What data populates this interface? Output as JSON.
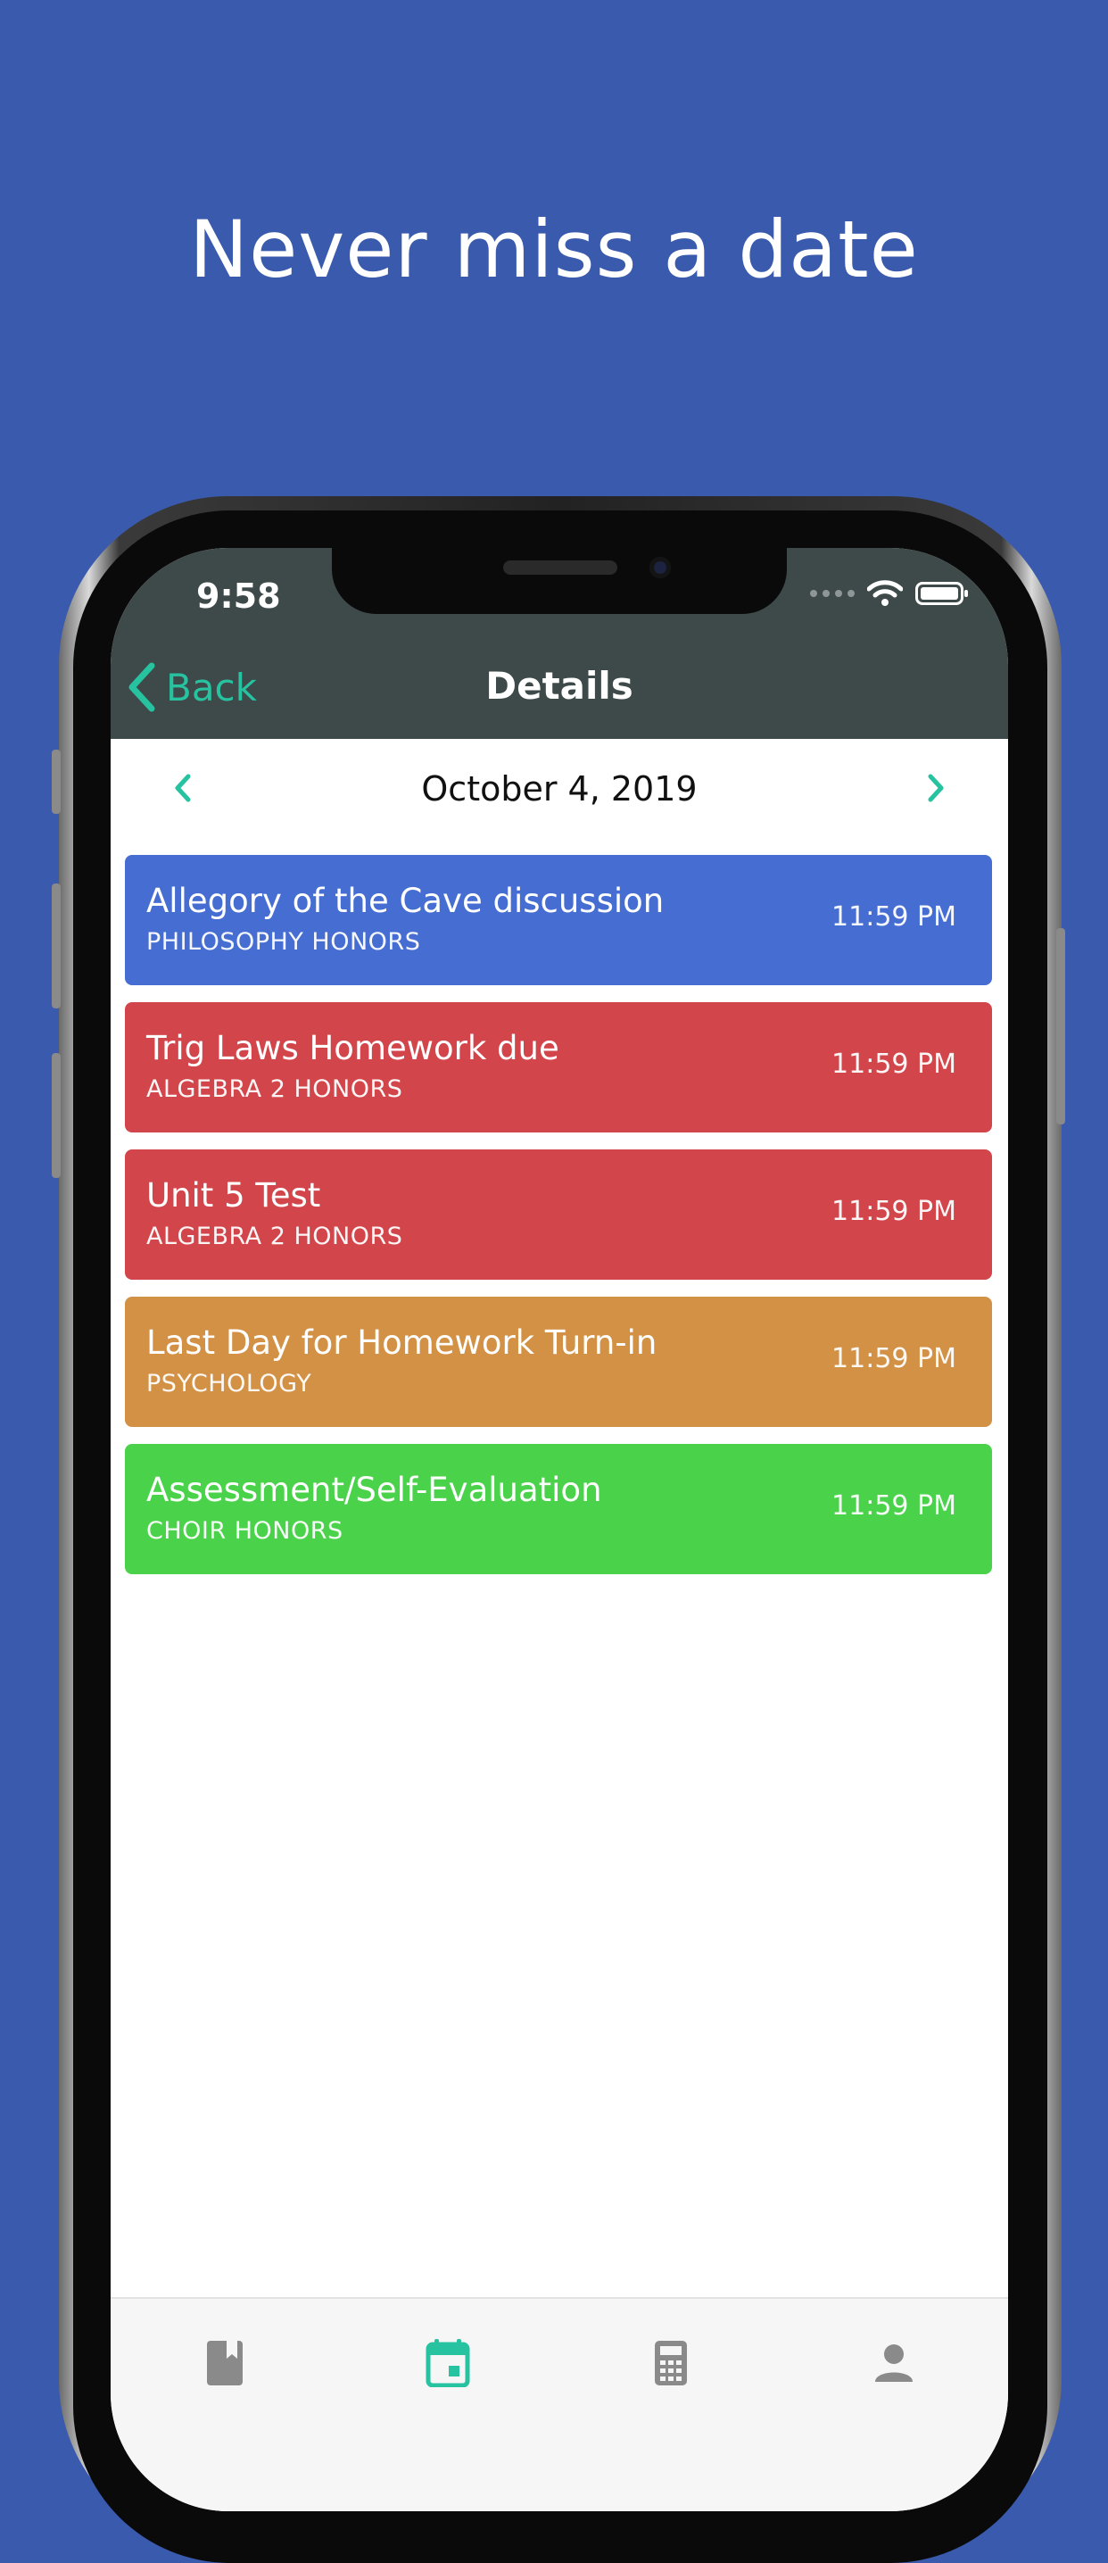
{
  "headline": "Never miss a date",
  "status_bar": {
    "time": "9:58"
  },
  "nav": {
    "back_label": "Back",
    "title": "Details"
  },
  "date": {
    "label": "October 4, 2019"
  },
  "colors": {
    "background": "#3a5aad",
    "accent": "#27c2a0",
    "topbar": "#3e4a49"
  },
  "assignments": [
    {
      "title": "Allegory of the Cave discussion",
      "course": "PHILOSOPHY HONORS",
      "time": "11:59 PM",
      "color": "#456dd2"
    },
    {
      "title": "Trig Laws Homework due",
      "course": "ALGEBRA 2 HONORS",
      "time": "11:59 PM",
      "color": "#d2454a"
    },
    {
      "title": "Unit 5 Test",
      "course": "ALGEBRA 2 HONORS",
      "time": "11:59 PM",
      "color": "#d2454a"
    },
    {
      "title": "Last Day for Homework Turn-in",
      "course": "PSYCHOLOGY",
      "time": "11:59 PM",
      "color": "#d39146"
    },
    {
      "title": "Assessment/Self-Evaluation",
      "course": "CHOIR HONORS",
      "time": "11:59 PM",
      "color": "#4ad24a"
    }
  ],
  "tabs": [
    {
      "icon": "book-icon",
      "active": false
    },
    {
      "icon": "calendar-icon",
      "active": true
    },
    {
      "icon": "calculator-icon",
      "active": false
    },
    {
      "icon": "person-icon",
      "active": false
    }
  ]
}
